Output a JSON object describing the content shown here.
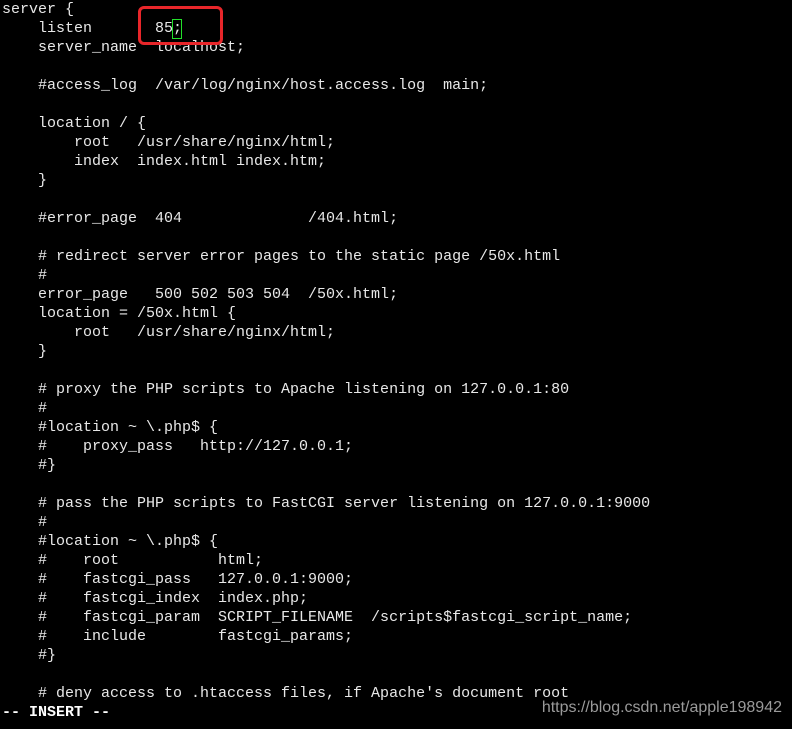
{
  "editor": {
    "lines": [
      "server {",
      "    listen       85;",
      "    server_name  localhost;",
      "",
      "    #access_log  /var/log/nginx/host.access.log  main;",
      "",
      "    location / {",
      "        root   /usr/share/nginx/html;",
      "        index  index.html index.htm;",
      "    }",
      "",
      "    #error_page  404              /404.html;",
      "",
      "    # redirect server error pages to the static page /50x.html",
      "    #",
      "    error_page   500 502 503 504  /50x.html;",
      "    location = /50x.html {",
      "        root   /usr/share/nginx/html;",
      "    }",
      "",
      "    # proxy the PHP scripts to Apache listening on 127.0.0.1:80",
      "    #",
      "    #location ~ \\.php$ {",
      "    #    proxy_pass   http://127.0.0.1;",
      "    #}",
      "",
      "    # pass the PHP scripts to FastCGI server listening on 127.0.0.1:9000",
      "    #",
      "    #location ~ \\.php$ {",
      "    #    root           html;",
      "    #    fastcgi_pass   127.0.0.1:9000;",
      "    #    fastcgi_index  index.php;",
      "    #    fastcgi_param  SCRIPT_FILENAME  /scripts$fastcgi_script_name;",
      "    #    include        fastcgi_params;",
      "    #}",
      "",
      "    # deny access to .htaccess files, if Apache's document root"
    ],
    "mode": "-- INSERT --",
    "highlight_color": "#e8262a",
    "cursor_color": "#22e02a"
  },
  "watermark": "https://blog.csdn.net/apple198942"
}
